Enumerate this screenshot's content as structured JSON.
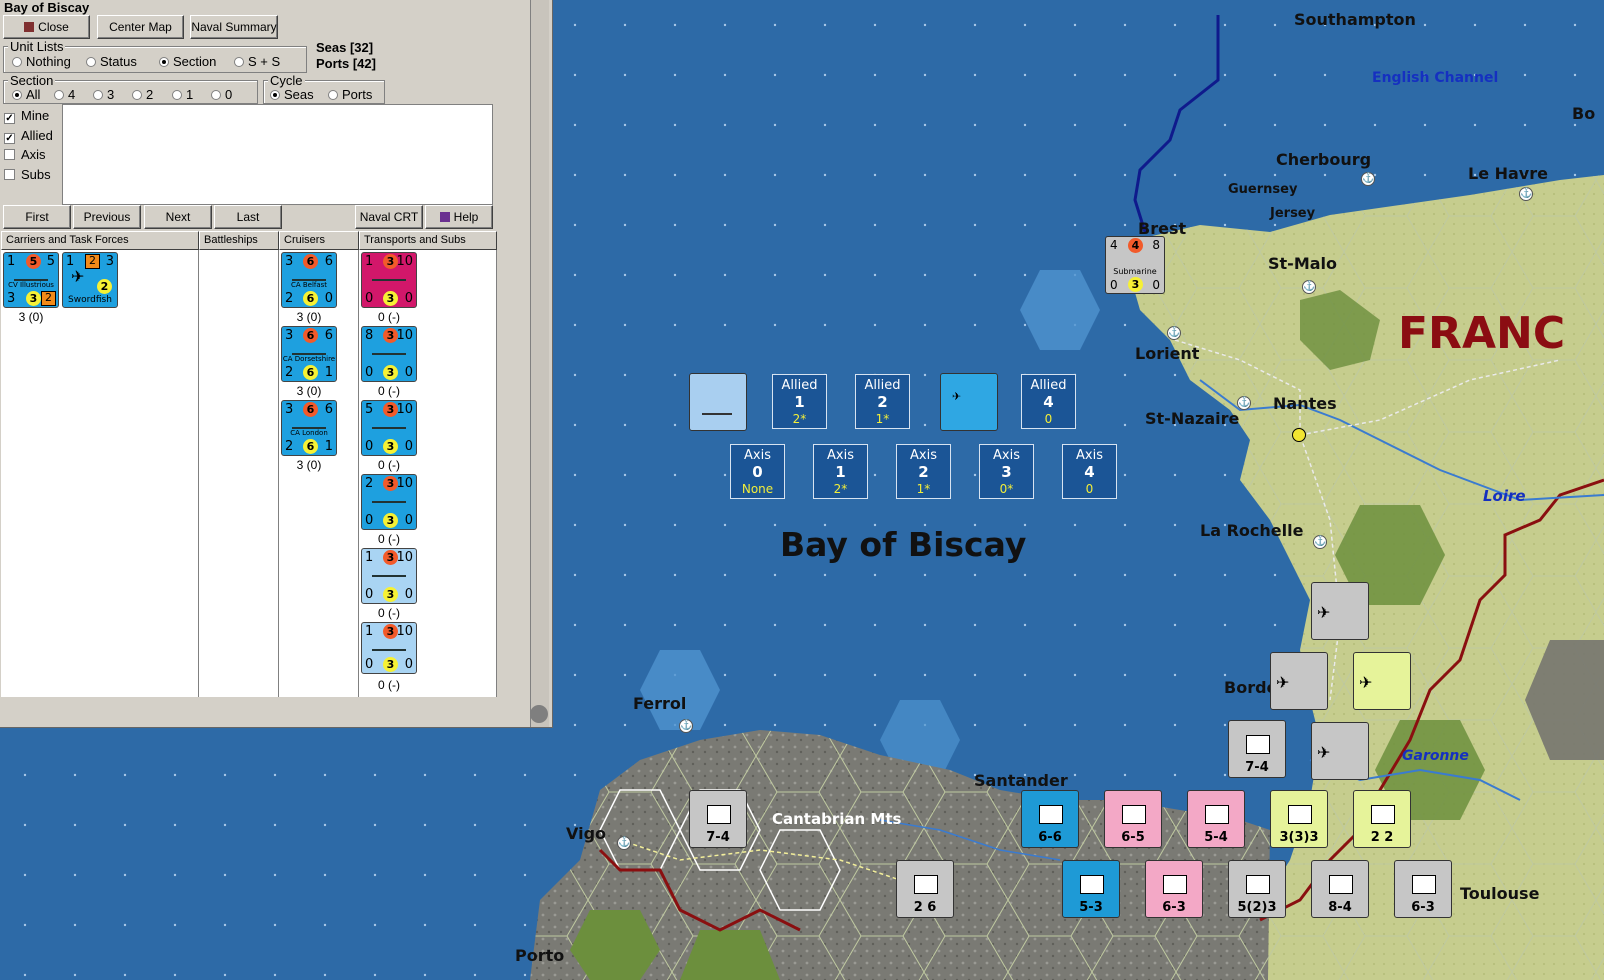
{
  "dialog": {
    "title": "Bay of Biscay",
    "buttons": {
      "close": "Close",
      "center_map": "Center Map",
      "naval_summary": "Naval Summary",
      "first": "First",
      "previous": "Previous",
      "next": "Next",
      "last": "Last",
      "naval_crt": "Naval CRT",
      "help": "Help"
    },
    "counts": {
      "seas": "Seas [32]",
      "ports": "Ports [42]"
    },
    "unit_lists": {
      "label": "Unit Lists",
      "options": [
        "Nothing",
        "Status",
        "Section",
        "S + S"
      ],
      "selected": "Section"
    },
    "section": {
      "label": "Section",
      "options": [
        "All",
        "4",
        "3",
        "2",
        "1",
        "0"
      ],
      "selected": "All"
    },
    "cycle": {
      "label": "Cycle",
      "options": [
        "Seas",
        "Ports"
      ],
      "selected": "Seas"
    },
    "filters": [
      {
        "label": "Mine",
        "checked": true
      },
      {
        "label": "Allied",
        "checked": true
      },
      {
        "label": "Axis",
        "checked": false
      },
      {
        "label": "Subs",
        "checked": false
      }
    ],
    "columns": [
      "Carriers and Task Forces",
      "Battleships",
      "Cruisers",
      "Transports and Subs"
    ],
    "carriers": {
      "units": [
        {
          "name": "CV Illustrious",
          "tl": "1",
          "tc": "5",
          "tr": "5",
          "bl": "3",
          "bc": "3",
          "br": "2"
        },
        {
          "name": "Swordfish",
          "tl": "1",
          "tc": "2",
          "tr": "3",
          "bc": "2"
        }
      ],
      "caption": "3 (0)"
    },
    "cruisers": [
      {
        "name": "CA Belfast",
        "tl": "3",
        "tc": "6",
        "tr": "6",
        "bl": "2",
        "bc": "6",
        "br": "0",
        "caption": "3 (0)"
      },
      {
        "name": "CA Dorsetshire",
        "tl": "3",
        "tc": "6",
        "tr": "6",
        "bl": "2",
        "bc": "6",
        "br": "1",
        "caption": "3 (0)"
      },
      {
        "name": "CA London",
        "tl": "3",
        "tc": "6",
        "tr": "6",
        "bl": "2",
        "bc": "6",
        "br": "1",
        "caption": "3 (0)"
      }
    ],
    "transports": [
      {
        "tl": "1",
        "tc": "3",
        "tr": "10",
        "bl": "0",
        "bc": "3",
        "br": "0",
        "caption": "0 (-)",
        "style": "mag"
      },
      {
        "tl": "8",
        "tc": "3",
        "tr": "10",
        "bl": "0",
        "bc": "3",
        "br": "0",
        "caption": "0 (-)",
        "style": "blue"
      },
      {
        "tl": "5",
        "tc": "3",
        "tr": "10",
        "bl": "0",
        "bc": "3",
        "br": "0",
        "caption": "0 (-)",
        "style": "blue"
      },
      {
        "tl": "2",
        "tc": "3",
        "tr": "10",
        "bl": "0",
        "bc": "3",
        "br": "0",
        "caption": "0 (-)",
        "style": "blue"
      },
      {
        "tl": "1",
        "tc": "3",
        "tr": "10",
        "bl": "0",
        "bc": "3",
        "br": "0",
        "caption": "0 (-)",
        "style": "lt"
      },
      {
        "tl": "1",
        "tc": "3",
        "tr": "10",
        "bl": "0",
        "bc": "3",
        "br": "0",
        "caption": "0 (-)",
        "style": "lt"
      }
    ]
  },
  "map": {
    "sea_name": "Bay of Biscay",
    "country": "FRANC",
    "water_labels": [
      "English Channel",
      "Loire",
      "Garonne"
    ],
    "places": [
      "Southampton",
      "Cherbourg",
      "Le Havre",
      "Guernsey",
      "Jersey",
      "Brest",
      "St-Malo",
      "Lorient",
      "Nantes",
      "St-Nazaire",
      "La Rochelle",
      "Ferrol",
      "Vigo",
      "Santander",
      "Bordeaux",
      "Porto",
      "Toulouse",
      "Bo"
    ],
    "terrain_labels": [
      "Cantabrian Mts"
    ],
    "allied_boxes": [
      {
        "side": "Allied",
        "num": "1",
        "val": "2*"
      },
      {
        "side": "Allied",
        "num": "2",
        "val": "1*"
      },
      {
        "side": "Allied",
        "num": "4",
        "val": "0"
      }
    ],
    "axis_boxes": [
      {
        "side": "Axis",
        "num": "0",
        "val": "None"
      },
      {
        "side": "Axis",
        "num": "1",
        "val": "2*"
      },
      {
        "side": "Axis",
        "num": "2",
        "val": "1*"
      },
      {
        "side": "Axis",
        "num": "3",
        "val": "0*"
      },
      {
        "side": "Axis",
        "num": "4",
        "val": "0"
      }
    ],
    "units": [
      {
        "lbl": "7-4",
        "style": "grey"
      },
      {
        "lbl": "6-6",
        "style": "blue"
      },
      {
        "lbl": "6-5",
        "style": "pink"
      },
      {
        "lbl": "5-4",
        "style": "pink"
      },
      {
        "lbl": "3(3)3",
        "style": "yellow"
      },
      {
        "lbl": "2 2",
        "style": "yellow"
      },
      {
        "lbl": "7-4",
        "style": "grey"
      },
      {
        "lbl": "2 6",
        "style": "grey"
      },
      {
        "lbl": "5-3",
        "style": "blue"
      },
      {
        "lbl": "6-3",
        "style": "pink"
      },
      {
        "lbl": "5(2)3",
        "style": "grey"
      },
      {
        "lbl": "8-4",
        "style": "grey"
      },
      {
        "lbl": "6-3",
        "style": "grey"
      }
    ],
    "submarine": {
      "name": "Submarine",
      "tl": "4",
      "tc": "4",
      "tr": "8",
      "bl": "0",
      "bc": "3",
      "br": "0"
    }
  }
}
